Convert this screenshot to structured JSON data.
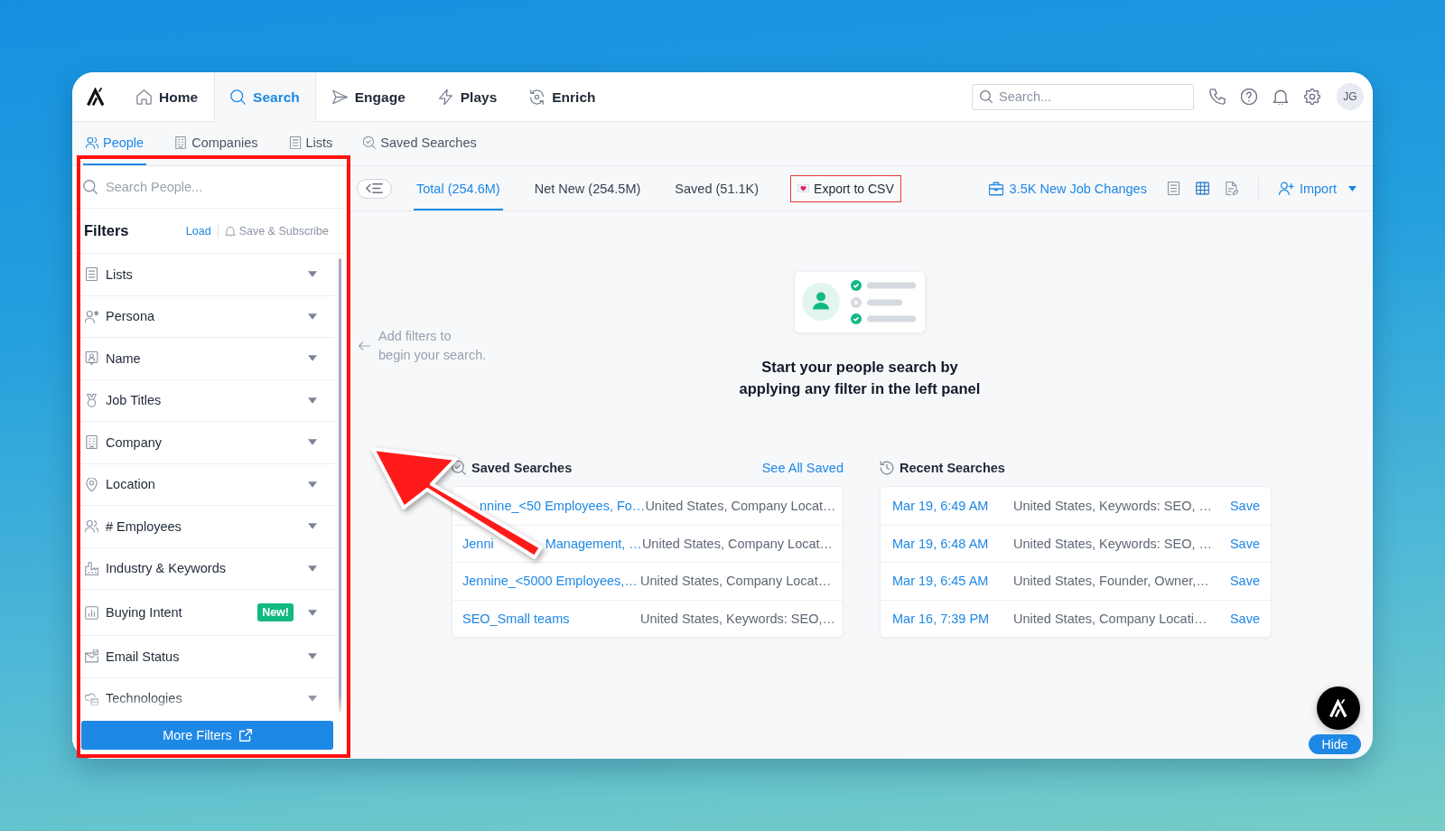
{
  "top_nav": {
    "tabs": [
      {
        "label": "Home",
        "selected": false
      },
      {
        "label": "Search",
        "selected": true
      },
      {
        "label": "Engage",
        "selected": false
      },
      {
        "label": "Plays",
        "selected": false
      },
      {
        "label": "Enrich",
        "selected": false
      }
    ],
    "search": {
      "placeholder": "Search..."
    },
    "avatar": "JG"
  },
  "sub_nav": {
    "tabs": [
      {
        "label": "People",
        "selected": true
      },
      {
        "label": "Companies",
        "selected": false
      },
      {
        "label": "Lists",
        "selected": false
      },
      {
        "label": "Saved Searches",
        "selected": false
      }
    ]
  },
  "filter_panel": {
    "search": {
      "placeholder": "Search People..."
    },
    "title": "Filters",
    "load_link": "Load",
    "subscribe_link": "Save & Subscribe",
    "filters": [
      {
        "label": "Lists",
        "expanded": false
      },
      {
        "label": "Persona",
        "expanded": false
      },
      {
        "label": "Name",
        "expanded": false
      },
      {
        "label": "Job Titles",
        "expanded": false
      },
      {
        "label": "Company",
        "expanded": false
      },
      {
        "label": "Location",
        "expanded": false
      },
      {
        "label": "# Employees",
        "expanded": false
      },
      {
        "label": "Industry & Keywords",
        "expanded": false
      },
      {
        "label": "Buying Intent",
        "badge": "New!",
        "expanded": false
      },
      {
        "label": "Email Status",
        "expanded": false
      },
      {
        "label": "Technologies",
        "expanded": false
      }
    ],
    "more_button": "More Filters"
  },
  "results_toolbar": {
    "tabs": [
      {
        "label": "Total (254.6M)",
        "selected": true
      },
      {
        "label": "Net New (254.5M)",
        "selected": false
      },
      {
        "label": "Saved (51.1K)",
        "selected": false
      }
    ],
    "export_button": "Export to CSV",
    "job_changes_link": "3.5K New Job Changes",
    "view_modes": [
      {
        "selected": false
      },
      {
        "selected": true
      },
      {
        "selected": false
      }
    ],
    "import_button": "Import"
  },
  "empty_state": {
    "hint": "Add filters to\nbegin your search.",
    "heading": "Start your people search by\napplying any filter in the left panel"
  },
  "saved_searches": {
    "title": "Saved Searches",
    "link": "See All Saved",
    "rows": [
      {
        "name_parts": [
          "nnine_<50 Employees, Fo…"
        ],
        "description": "United States, Company Locat…"
      },
      {
        "name_parts": [
          "Jenni",
          "Management, …"
        ],
        "description": "United States, Company Locat…"
      },
      {
        "name_parts": [
          "Jennine_<5000 Employees,…"
        ],
        "description": "United States, Company Locat…"
      },
      {
        "name_parts": [
          "SEO_Small teams"
        ],
        "description": "United States, Keywords: SEO,…"
      }
    ]
  },
  "recent_searches": {
    "title": "Recent Searches",
    "rows": [
      {
        "date": "Mar 19, 6:49 AM",
        "description": "United States, Keywords: SEO, …",
        "action": "Save"
      },
      {
        "date": "Mar 19, 6:48 AM",
        "description": "United States, Keywords: SEO, …",
        "action": "Save"
      },
      {
        "date": "Mar 19, 6:45 AM",
        "description": "United States, Founder, Owner,…",
        "action": "Save"
      },
      {
        "date": "Mar 16, 7:39 PM",
        "description": "United States, Company Locati…",
        "action": "Save"
      }
    ]
  },
  "assistant": {
    "hide_button": "Hide"
  }
}
